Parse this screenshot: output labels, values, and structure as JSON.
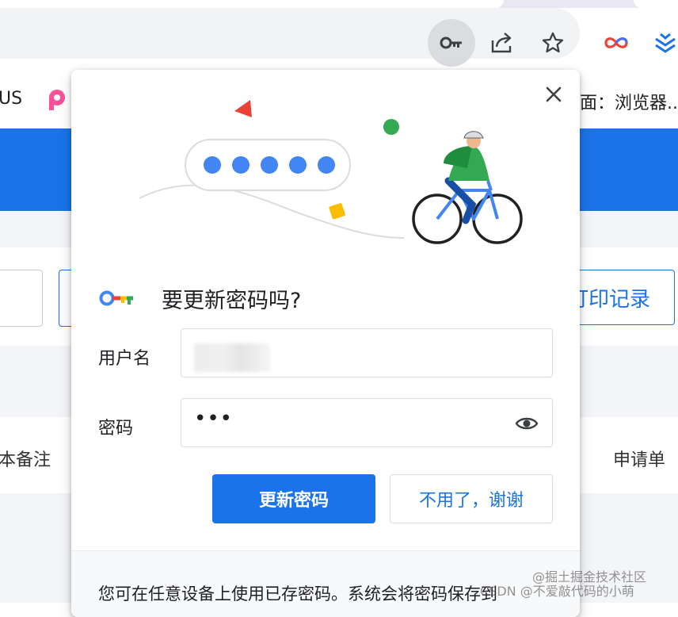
{
  "bookmarks_bar": {
    "left_text": "US",
    "right_text": "面：浏览器..."
  },
  "background_page": {
    "right_button_label": "打印记录",
    "left_column_label": "本备注",
    "right_column_label": "申请单"
  },
  "dialog": {
    "title": "要更新密码吗?",
    "username_label": "用户名",
    "password_label": "密码",
    "password_masked": "•••",
    "update_button_label": "更新密码",
    "dismiss_button_label": "不用了，谢谢",
    "footer_text": "您可在任意设备上使用已存密码。系统会将密码保存到"
  },
  "watermark": {
    "line1": "@掘土掘金技术社区",
    "line2": "CSDN @不爱敲代码的小萌"
  },
  "colors": {
    "accent": "#1a73e8",
    "illustration_blue": "#4285f4",
    "illustration_green": "#34a853",
    "illustration_red": "#ea4335",
    "illustration_yellow": "#fbbc04"
  }
}
